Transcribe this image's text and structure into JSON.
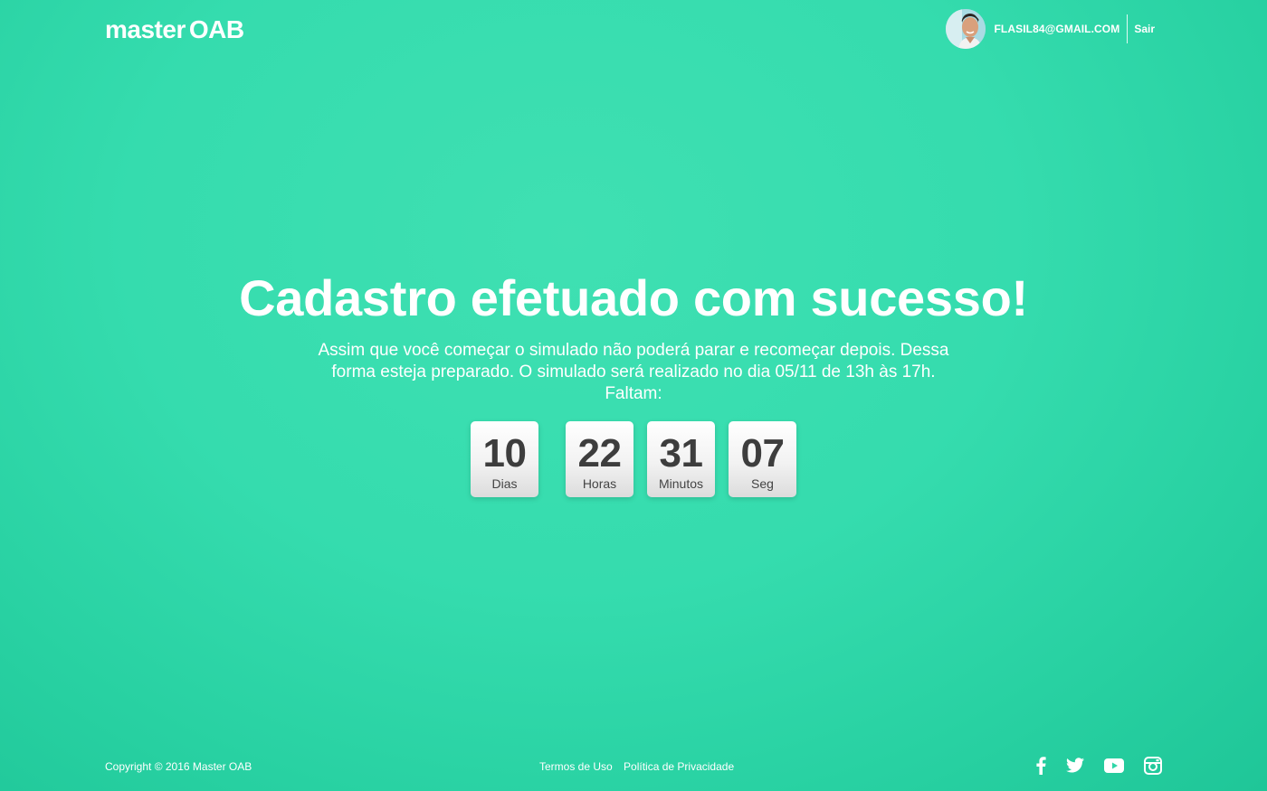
{
  "header": {
    "logo_part1": "master",
    "logo_part2": "OAB",
    "user_email": "FLASIL84@GMAIL.COM",
    "logout_label": "Sair"
  },
  "main": {
    "headline": "Cadastro efetuado com sucesso!",
    "message": "Assim que você começar o simulado não poderá parar e recomeçar depois. Dessa forma esteja preparado. O simulado será realizado no dia 05/11 de 13h às 17h.",
    "remaining_label": "Faltam:",
    "countdown": [
      {
        "value": "10",
        "label": "Dias"
      },
      {
        "value": "22",
        "label": "Horas"
      },
      {
        "value": "31",
        "label": "Minutos"
      },
      {
        "value": "07",
        "label": "Seg"
      }
    ]
  },
  "footer": {
    "copyright": "Copyright © 2016 Master OAB",
    "links": [
      "Termos de Uso",
      "Política de Privacidade"
    ],
    "social": [
      "facebook-icon",
      "twitter-icon",
      "youtube-icon",
      "instagram-icon"
    ]
  },
  "colors": {
    "background": "#3ddfb0",
    "text": "#ffffff",
    "counter_text": "#3d3d3d"
  }
}
